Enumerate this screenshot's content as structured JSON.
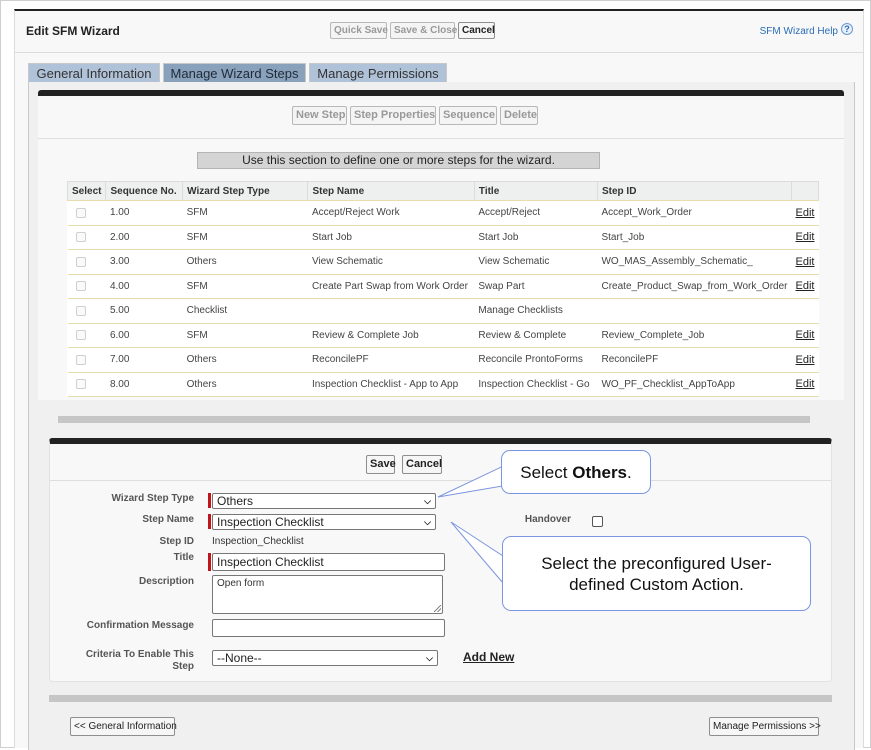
{
  "header": {
    "title": "Edit SFM Wizard",
    "buttons": {
      "quick_save": "Quick Save",
      "save_close": "Save & Close",
      "cancel": "Cancel"
    },
    "help_link": "SFM Wizard Help",
    "help_icon": "?"
  },
  "tabs": [
    {
      "label": "General Information",
      "selected": false
    },
    {
      "label": "Manage Wizard Steps",
      "selected": true
    },
    {
      "label": "Manage Permissions",
      "selected": false
    }
  ],
  "steps_toolbar": {
    "new_step": "New Step",
    "step_properties": "Step Properties",
    "sequence": "Sequence",
    "delete": "Delete"
  },
  "section_banner": "Use this section to define one or more steps for the wizard.",
  "steps_table": {
    "columns": [
      "Select",
      "Sequence No.",
      "Wizard Step Type",
      "Step Name",
      "Title",
      "Step ID",
      ""
    ],
    "edit_label": "Edit",
    "rows": [
      {
        "seq": "1.00",
        "type": "SFM",
        "name": "Accept/Reject Work",
        "title": "Accept/Reject",
        "step_id": "Accept_Work_Order",
        "edit": "Edit"
      },
      {
        "seq": "2.00",
        "type": "SFM",
        "name": "Start Job",
        "title": "Start Job",
        "step_id": "Start_Job",
        "edit": "Edit"
      },
      {
        "seq": "3.00",
        "type": "Others",
        "name": "View Schematic",
        "title": "View Schematic",
        "step_id": "WO_MAS_Assembly_Schematic_",
        "edit": "Edit"
      },
      {
        "seq": "4.00",
        "type": "SFM",
        "name": "Create Part Swap from Work Order",
        "title": "Swap Part",
        "step_id": "Create_Product_Swap_from_Work_Order",
        "edit": "Edit"
      },
      {
        "seq": "5.00",
        "type": "Checklist",
        "name": "",
        "title": "Manage Checklists",
        "step_id": "",
        "edit": ""
      },
      {
        "seq": "6.00",
        "type": "SFM",
        "name": "Review & Complete Job",
        "title": "Review & Complete",
        "step_id": "Review_Complete_Job",
        "edit": "Edit"
      },
      {
        "seq": "7.00",
        "type": "Others",
        "name": "ReconcilePF",
        "title": "Reconcile ProntoForms",
        "step_id": "ReconcilePF",
        "edit": "Edit"
      },
      {
        "seq": "8.00",
        "type": "Others",
        "name": "Inspection Checklist - App to App",
        "title": "Inspection Checklist - Go",
        "step_id": "WO_PF_Checklist_AppToApp",
        "edit": "Edit"
      }
    ]
  },
  "step_detail": {
    "save": "Save",
    "cancel": "Cancel",
    "fields": {
      "wizard_step_type": {
        "label": "Wizard Step Type",
        "value": "Others"
      },
      "step_name": {
        "label": "Step Name",
        "value": "Inspection Checklist"
      },
      "step_id": {
        "label": "Step ID",
        "value": "Inspection_Checklist"
      },
      "title": {
        "label": "Title",
        "value": "Inspection Checklist"
      },
      "description": {
        "label": "Description",
        "value": "Open form"
      },
      "confirmation_message": {
        "label": "Confirmation Message",
        "value": ""
      },
      "criteria": {
        "label_line1": "Criteria To Enable This",
        "label_line2": "Step",
        "value": "--None--"
      },
      "handover": {
        "label": "Handover",
        "checked": false
      }
    },
    "add_new": "Add New"
  },
  "callouts": {
    "select_others_prefix": "Select ",
    "select_others_bold": "Others",
    "select_others_suffix": ".",
    "custom_action_line1": "Select the preconfigured User-",
    "custom_action_line2": "defined Custom Action."
  },
  "footer": {
    "prev": "<< General Information",
    "next": "Manage Permissions >>"
  },
  "icons": {
    "chevron": "⌄",
    "help": "question-circle-icon"
  }
}
